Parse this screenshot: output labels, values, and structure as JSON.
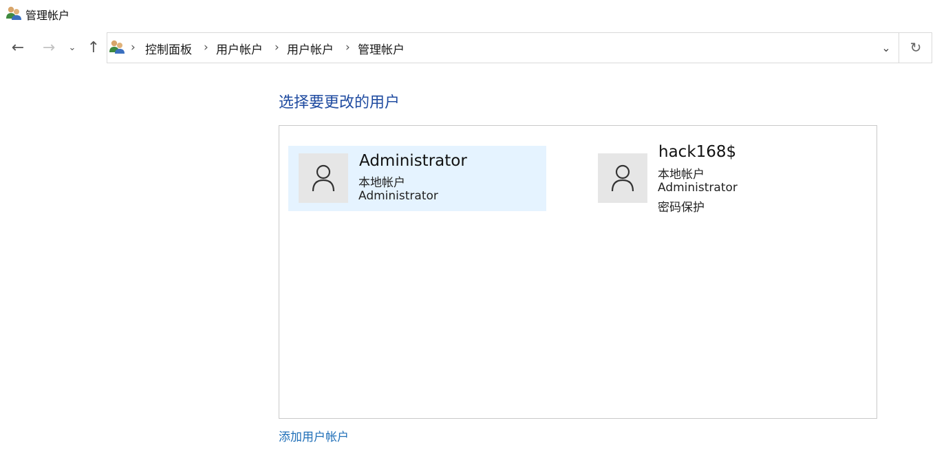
{
  "window": {
    "title": "管理帐户",
    "icon": "users-group-icon"
  },
  "nav": {
    "back_icon": "←",
    "forward_icon": "→",
    "recent_icon": "⌄",
    "up_icon": "↑"
  },
  "address": {
    "crumbs": [
      "控制面板",
      "用户帐户",
      "用户帐户",
      "管理帐户"
    ],
    "separator": "›",
    "dropdown_icon": "⌄",
    "refresh_icon": "↻"
  },
  "main": {
    "heading": "选择要更改的用户",
    "users": [
      {
        "name": "Administrator",
        "lines": [
          "本地帐户",
          "Administrator"
        ],
        "selected": true
      },
      {
        "name": "hack168$",
        "lines": [
          "本地帐户",
          "Administrator",
          "密码保护"
        ],
        "selected": false
      }
    ],
    "add_link": "添加用户帐户"
  },
  "colors": {
    "heading": "#1f4ba0",
    "link": "#1f6fb8",
    "selected_bg": "#e5f3ff",
    "avatar_bg": "#e6e6e6"
  }
}
